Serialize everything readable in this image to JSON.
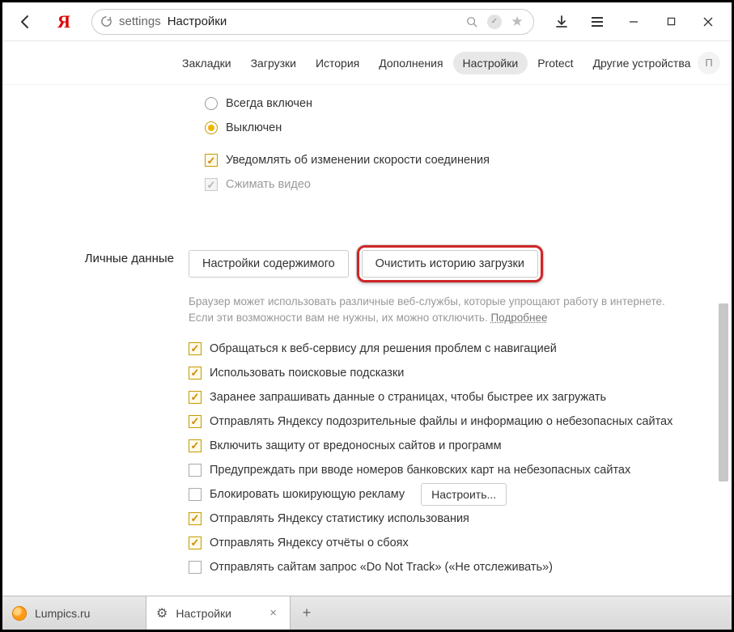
{
  "address": {
    "prefix": "settings",
    "title": "Настройки"
  },
  "nav": {
    "tabs": [
      {
        "label": "Закладки"
      },
      {
        "label": "Загрузки"
      },
      {
        "label": "История"
      },
      {
        "label": "Дополнения"
      },
      {
        "label": "Настройки"
      },
      {
        "label": "Protect"
      },
      {
        "label": "Другие устройства"
      }
    ],
    "profile_initial": "П"
  },
  "turbo": {
    "radio_always": "Всегда включен",
    "radio_off": "Выключен",
    "notify_speed": "Уведомлять об изменении скорости соединения",
    "compress_video": "Сжимать видео"
  },
  "privacy": {
    "section_title": "Личные данные",
    "content_settings_btn": "Настройки содержимого",
    "clear_history_btn": "Очистить историю загрузки",
    "desc_text": "Браузер может использовать различные веб-службы, которые упрощают работу в интернете. Если эти возможности вам не нужны, их можно отключить. ",
    "desc_more": "Подробнее",
    "items": [
      "Обращаться к веб-сервису для решения проблем с навигацией",
      "Использовать поисковые подсказки",
      "Заранее запрашивать данные о страницах, чтобы быстрее их загружать",
      "Отправлять Яндексу подозрительные файлы и информацию о небезопасных сайтах",
      "Включить защиту от вредоносных сайтов и программ",
      "Предупреждать при вводе номеров банковских карт на небезопасных сайтах",
      "Блокировать шокирующую рекламу",
      "Отправлять Яндексу статистику использования",
      "Отправлять Яндексу отчёты о сбоях",
      "Отправлять сайтам запрос «Do Not Track» («Не отслеживать»)"
    ],
    "configure_btn": "Настроить..."
  },
  "tabs_bottom": {
    "tab1": "Lumpics.ru",
    "tab2": "Настройки"
  }
}
